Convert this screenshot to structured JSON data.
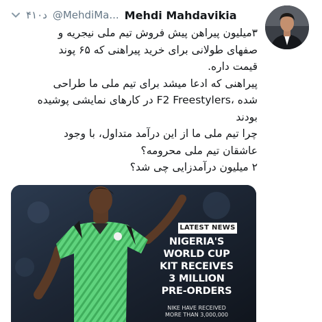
{
  "tweet": {
    "author_name": "Mehdi Mahdavikia",
    "handle": "@MehdiMa...",
    "time": "۴۱۰د",
    "body_lines": [
      "۳میلیون پیراهن پیش فروش تیم ملی نیجریه و",
      "صفهای طولانی برای خرید پیراهنی که ۶۵ پوند",
      "قیمت داره.",
      "پیراهنی که ادعا میشد برای تیم ملی ما طراحی",
      "شده ،F2 Freestylers در کارهای نمایشی پوشیده",
      "بودند",
      "چرا تیم ملی ما از این درآمد متداول، با وجود",
      "عاشقان تیم ملی محرومه؟",
      "۲ میلیون درآمدزایی چی شد؟"
    ]
  },
  "media": {
    "tag": "LATEST NEWS",
    "headline_lines": [
      "NIGERIA'S",
      "WORLD CUP",
      "KIT RECEIVES",
      "3 MILLION",
      "PRE-ORDERS"
    ],
    "subline_lines": [
      "NIKE HAVE RECEIVED",
      "MORE THAN 3,000,000"
    ]
  },
  "icons": {
    "menu": "chevron-down-icon"
  },
  "colors": {
    "secondary_text": "#657786",
    "jersey_green": "#5fd37d",
    "media_bg": "#1f2836"
  }
}
